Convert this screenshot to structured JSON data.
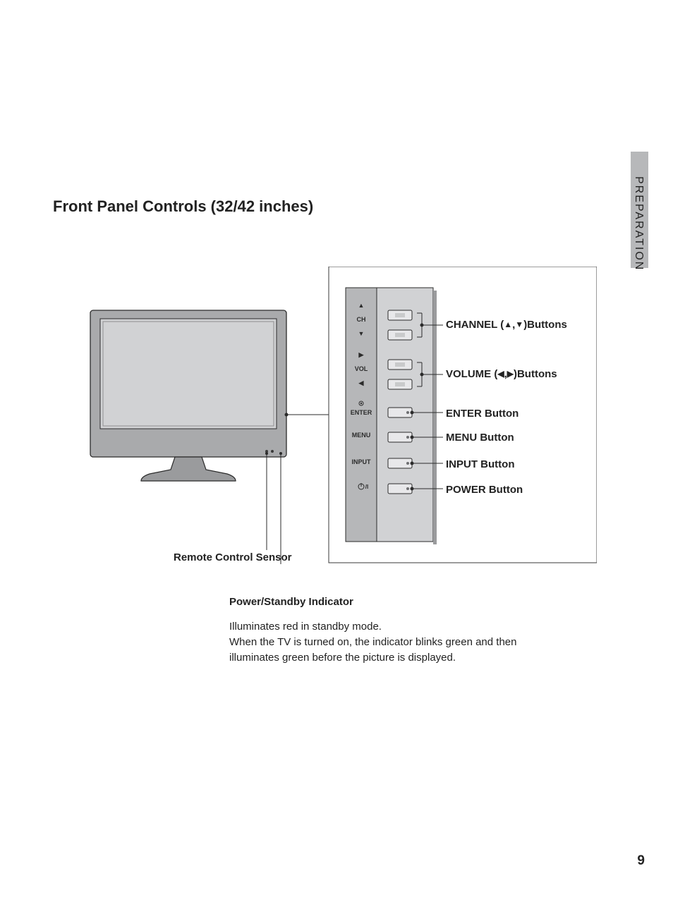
{
  "section": "PREPARATION",
  "title": "Front Panel Controls (32/42 inches)",
  "page_number": "9",
  "panel": {
    "ch_label": "CH",
    "vol_label": "VOL",
    "enter_label": "ENTER",
    "menu_label": "MENU",
    "input_label": "INPUT"
  },
  "callouts": {
    "channel_pre": "CHANNEL (",
    "channel_post": ")Buttons",
    "volume_pre": "VOLUME (",
    "volume_post": ")Buttons",
    "enter": "ENTER Button",
    "menu": "MENU Button",
    "input": "INPUT Button",
    "power": "POWER Button"
  },
  "remote_sensor": "Remote Control Sensor",
  "indicator": {
    "title": "Power/Standby Indicator",
    "body": "Illuminates red in standby mode.\nWhen the TV is turned on, the indicator blinks green and then illuminates green before the picture is displayed."
  }
}
